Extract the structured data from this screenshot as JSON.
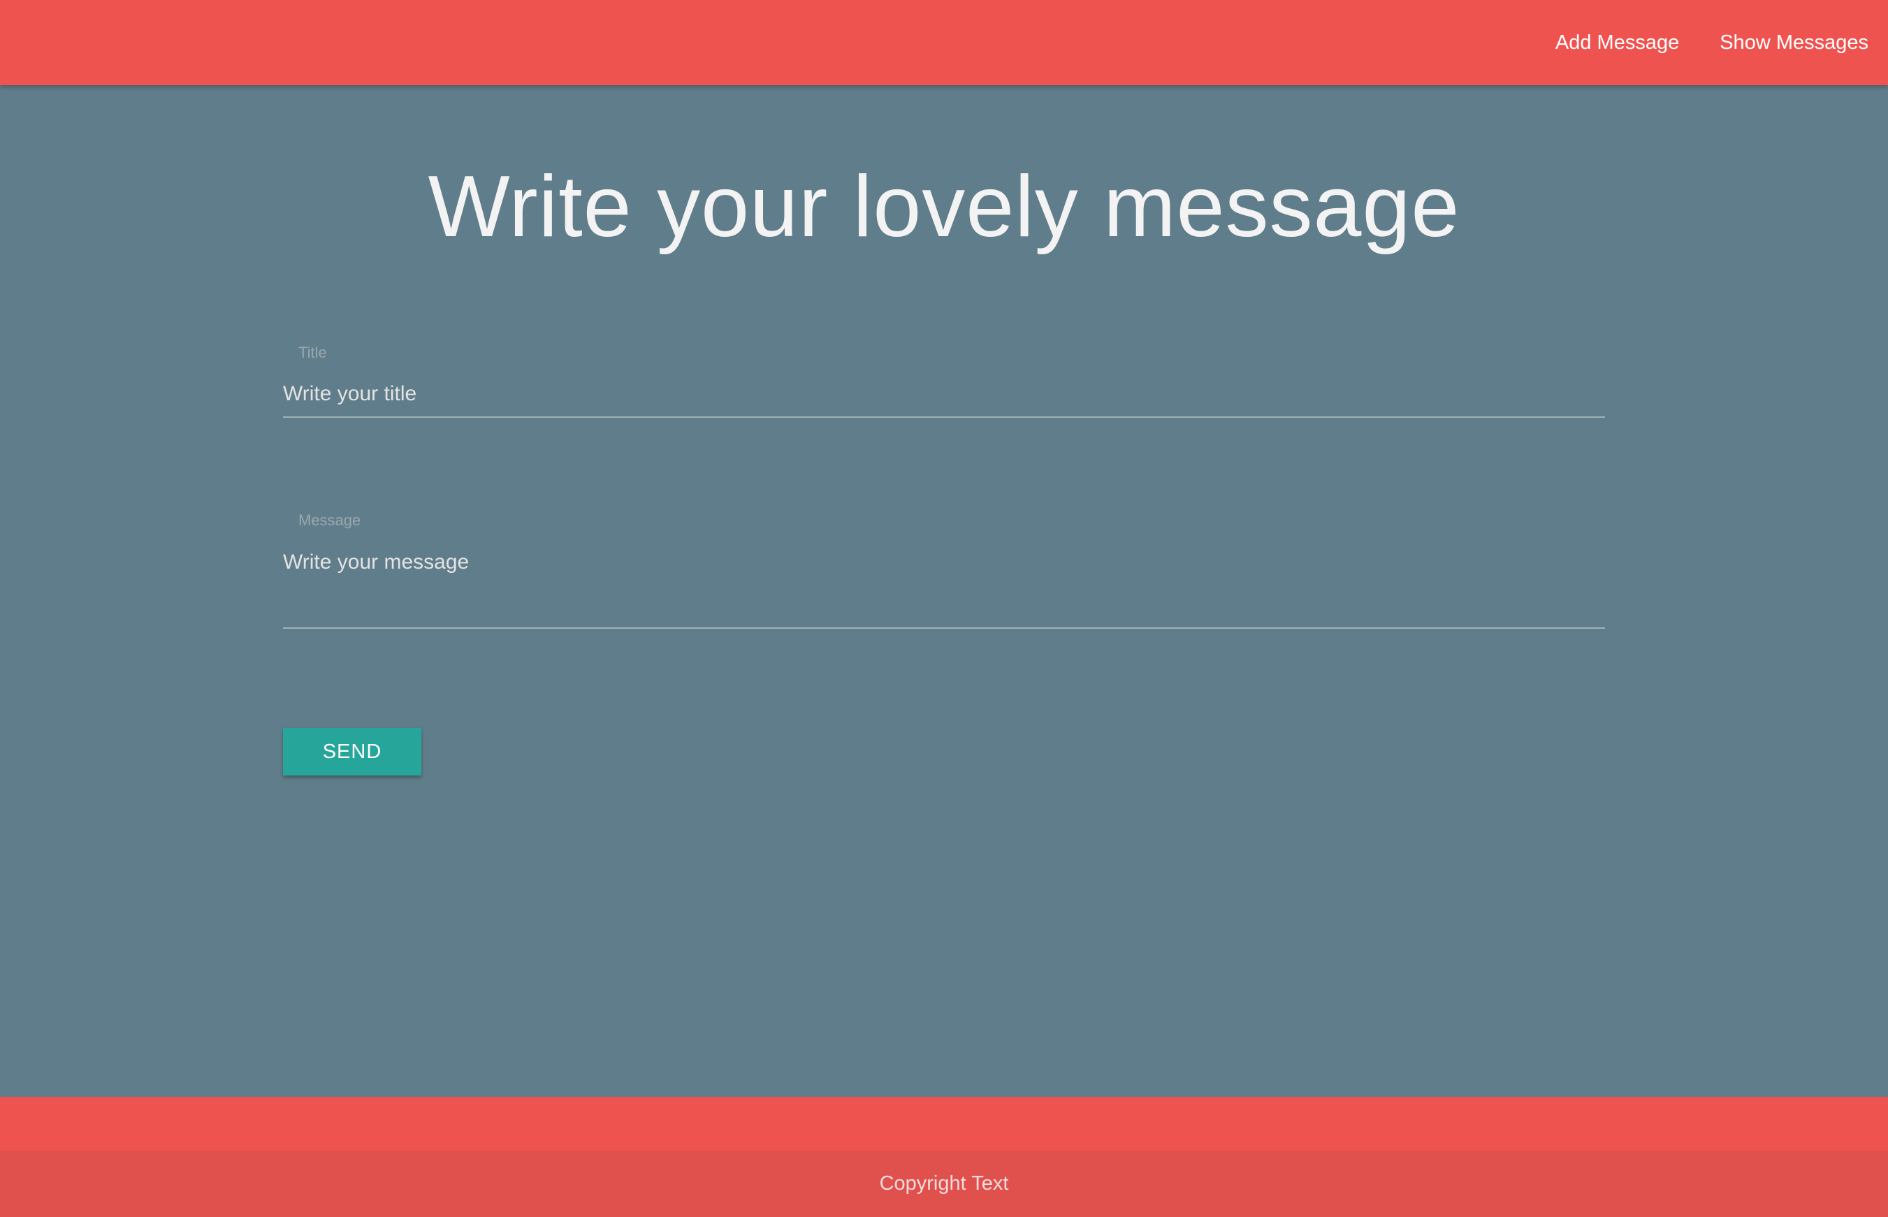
{
  "navbar": {
    "links": [
      {
        "label": "Add Message"
      },
      {
        "label": "Show Messages"
      }
    ]
  },
  "main": {
    "title": "Write your lovely message",
    "form": {
      "title_field": {
        "label": "Title",
        "placeholder": "Write your title",
        "value": ""
      },
      "message_field": {
        "label": "Message",
        "placeholder": "Write your message",
        "value": ""
      },
      "send_label": "SEND"
    }
  },
  "footer": {
    "copyright": "Copyright Text"
  },
  "colors": {
    "navbar": "#ef5350",
    "background": "#607d8b",
    "button": "#26a69a",
    "footer_copyright": "#e0504c"
  }
}
